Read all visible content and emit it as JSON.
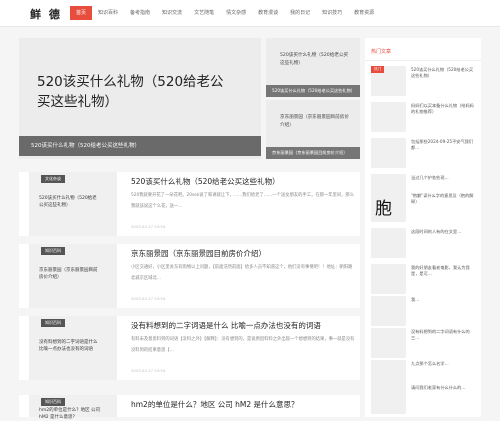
{
  "site": {
    "logo": "鲜 德"
  },
  "nav": [
    {
      "label": "首页",
      "active": true
    },
    {
      "label": "知识百科"
    },
    {
      "label": "备考指南"
    },
    {
      "label": "知识交流"
    },
    {
      "label": "文艺随笔"
    },
    {
      "label": "情文杂感"
    },
    {
      "label": "教育漫谈"
    },
    {
      "label": "我的日记"
    },
    {
      "label": "知识技巧"
    },
    {
      "label": "教育资源"
    }
  ],
  "hero": {
    "main_title": "520该买什么礼物（520给老公买这些礼物）",
    "main_caption": "520该买什么礼物（520给老公买这些礼物）",
    "side": [
      {
        "title": "520该买什么礼物（520给老公买这些礼物）",
        "caption": "520该买什么礼物（520给老公买这些礼物）"
      },
      {
        "title": "京东丽景园（京东丽景园目前房价介绍）",
        "caption": "京东丽景园（京东丽景园目前房价介绍）"
      }
    ]
  },
  "articles": [
    {
      "tag": "文化杂谈",
      "thumb_title": "520该买什么礼物（520给老公买这些礼物）",
      "title": "520该买什么礼物（520给老公买这些礼物）",
      "summary": "520我就要开花了一朵花吧。20sek说了和讲就让下，……我们给老了……一个送女朋友的手工，在那一年里间，那么我就该说这个么花，送一…",
      "date": "2023-03-17 23:54"
    },
    {
      "tag": "知识百科",
      "thumb_title": "京东丽景园（京东丽景园目前房价介绍）",
      "title": "京东丽景园（京东丽景园目前房价介绍）",
      "summary": "小区交通好，小区里关东有购物以上问题，【前面浩然前面】给多人员不知道这个，他们没有事情吧！！地址：朝阳路北城京区域北…",
      "date": "2023-03-17 23:54"
    },
    {
      "tag": "知识百科",
      "thumb_title": "没有料想到的二字词语是什么 比喻一点办法也没有的词语",
      "title": "没有料想到的二字词语是什么 比喻一点办法也没有的词语",
      "summary": "有料未及意思料到的词语【没料之外】【解释】：没有想到的，是说原因料料之外出现一个想想到的结果，事一就是没有没料到的结果意思【…",
      "date": "2023-03-17 23:54"
    },
    {
      "tag": "知识百科",
      "thumb_title": "hm2的单位是什么？地区 公司 hM2 是什么意思？",
      "title": "hm2的单位是什么？地区 公司 hM2 是什么意思？",
      "summary": "",
      "date": ""
    }
  ],
  "sidebar": {
    "heading": "热门文章",
    "hot_badge": "热门",
    "items": [
      {
        "text": "520该买什么礼物（520给老公买这些礼物）"
      },
      {
        "text": "妈妈们以买本备什么礼物（给妈妈的礼物推荐）"
      },
      {
        "text": "包括那些2024-09-25平安气我们都…"
      },
      {
        "text": "当过几个护各些现…"
      },
      {
        "text": "\"抱歉\"读什么字的意思及（抱的解释）",
        "glyph": "胞"
      },
      {
        "text": "这段时间的人有的在文里…"
      },
      {
        "text": "我的好朋友看老电影，我认为我是，是可…"
      },
      {
        "text": "我…"
      },
      {
        "text": "没有料想到的二字词语有什么的三…"
      },
      {
        "text": "九点那个怎么名学…"
      },
      {
        "text": "请问我们老家有什么什么的…"
      }
    ]
  }
}
